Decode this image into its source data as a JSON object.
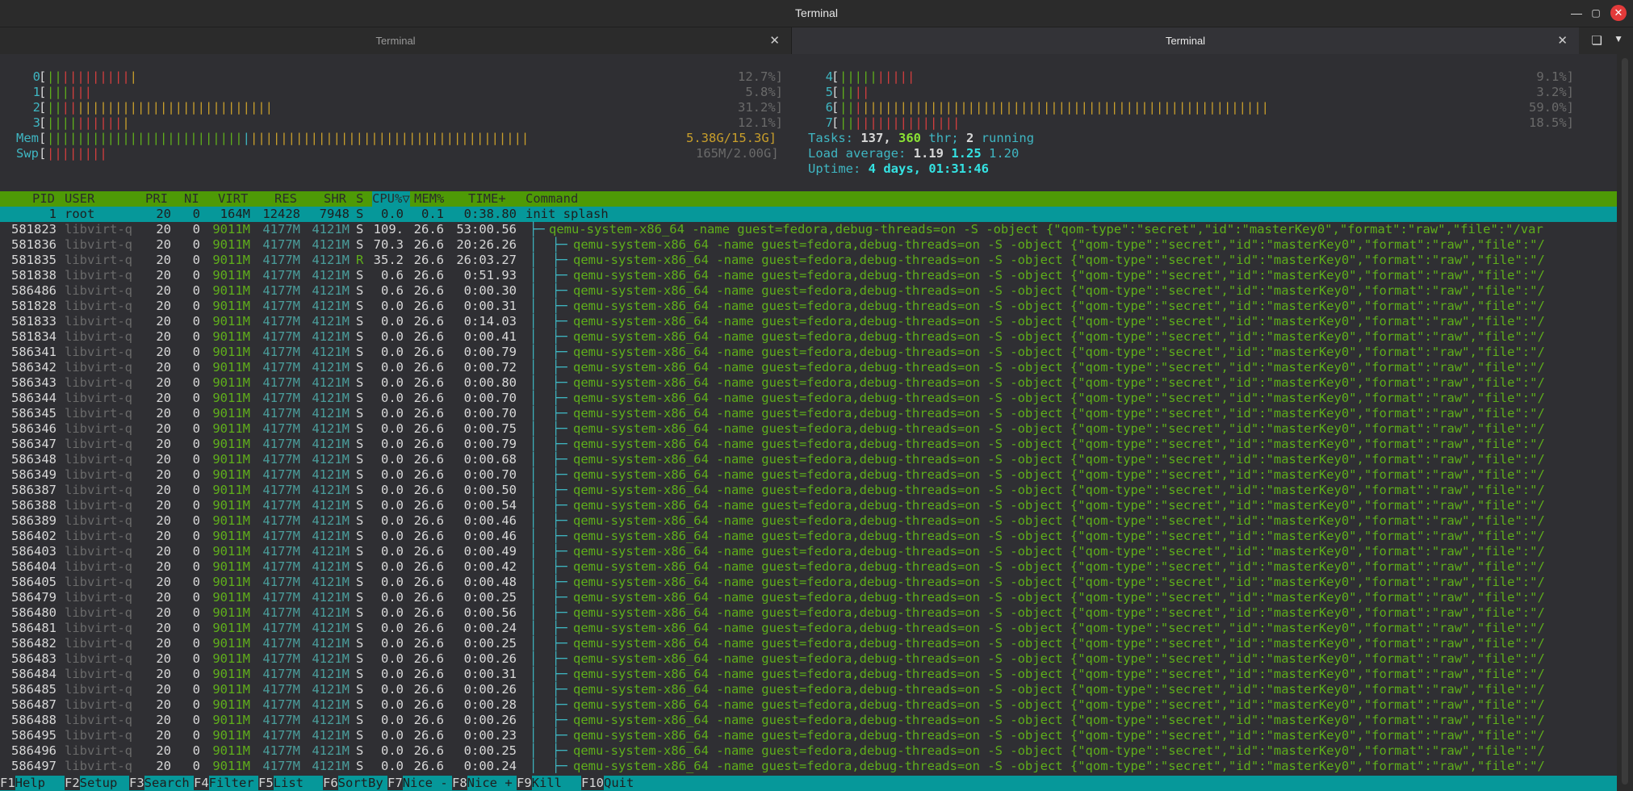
{
  "window": {
    "title": "Terminal"
  },
  "tabs": [
    {
      "label": "Terminal",
      "active": false
    },
    {
      "label": "Terminal",
      "active": true
    }
  ],
  "icons": {
    "minimize": "minimize-icon",
    "maximize": "maximize-icon",
    "close": "close-icon",
    "tab_close": "close-icon",
    "new_tab": "new-tab-icon",
    "tab_menu": "chevron-down-icon"
  },
  "meters": {
    "cpus": [
      {
        "id": "0",
        "value": "12.7%]",
        "bar_green": 2,
        "bar_red": 9,
        "bar_yellow": 1
      },
      {
        "id": "1",
        "value": "5.8%]",
        "bar_green": 3,
        "bar_red": 3,
        "bar_yellow": 0
      },
      {
        "id": "2",
        "value": "31.2%]",
        "bar_green": 2,
        "bar_red": 2,
        "bar_yellow": 26
      },
      {
        "id": "3",
        "value": "12.1%]",
        "bar_green": 4,
        "bar_red": 6,
        "bar_yellow": 1
      },
      {
        "id": "4",
        "value": "9.1%]",
        "bar_green": 5,
        "bar_red": 5,
        "bar_yellow": 0
      },
      {
        "id": "5",
        "value": "3.2%]",
        "bar_green": 2,
        "bar_red": 2,
        "bar_yellow": 0
      },
      {
        "id": "6",
        "value": "59.0%]",
        "bar_green": 2,
        "bar_red": 1,
        "bar_yellow": 54
      },
      {
        "id": "7",
        "value": "18.5%]",
        "bar_green": 2,
        "bar_red": 14,
        "bar_yellow": 0
      }
    ],
    "mem": {
      "label": "Mem",
      "value": "5.38G/15.3G]"
    },
    "swp": {
      "label": "Swp",
      "value": "165M/2.00G]"
    },
    "tasks": {
      "label": "Tasks:",
      "count": "137,",
      "thr": "360",
      "thr_label": "thr;",
      "running": "2",
      "running_label": "running"
    },
    "load": {
      "label": "Load average:",
      "l1": "1.19",
      "l5": "1.25",
      "l15": "1.20"
    },
    "uptime": {
      "label": "Uptime:",
      "value": "4 days, 01:31:46"
    }
  },
  "columns": {
    "pid": "PID",
    "user": "USER",
    "pri": "PRI",
    "ni": "NI",
    "virt": "VIRT",
    "res": "RES",
    "shr": "SHR",
    "s": "S",
    "cpu": "CPU%▽",
    "mem": "MEM%",
    "time": "TIME+",
    "command": "Command"
  },
  "processes": [
    {
      "pid": "1",
      "user": "root",
      "pri": "20",
      "ni": "0",
      "virt": "164M",
      "res": "12428",
      "shr": "7948",
      "s": "S",
      "cpu": "0.0",
      "mem": "0.1",
      "time": "0:38.80",
      "tree": "",
      "cmd": "init splash",
      "selected": true
    },
    {
      "pid": "581823",
      "user": "libvirt-q",
      "pri": "20",
      "ni": "0",
      "virt": "9011M",
      "res": "4177M",
      "shr": "4121M",
      "s": "S",
      "cpu": "109.",
      "mem": "26.6",
      "time": "53:00.56",
      "tree": "├─",
      "cmd": "qemu-system-x86_64 -name guest=fedora,debug-threads=on -S -object {\"qom-type\":\"secret\",\"id\":\"masterKey0\",\"format\":\"raw\",\"file\":\"/var"
    },
    {
      "pid": "581836",
      "user": "libvirt-q",
      "pri": "20",
      "ni": "0",
      "virt": "9011M",
      "res": "4177M",
      "shr": "4121M",
      "s": "S",
      "cpu": "70.3",
      "mem": "26.6",
      "time": "20:26.26",
      "tree": "│  ├─",
      "cmd": "qemu-system-x86_64 -name guest=fedora,debug-threads=on -S -object {\"qom-type\":\"secret\",\"id\":\"masterKey0\",\"format\":\"raw\",\"file\":\"/"
    },
    {
      "pid": "581835",
      "user": "libvirt-q",
      "pri": "20",
      "ni": "0",
      "virt": "9011M",
      "res": "4177M",
      "shr": "4121M",
      "s": "R",
      "cpu": "35.2",
      "mem": "26.6",
      "time": "26:03.27",
      "tree": "│  ├─",
      "cmd": "qemu-system-x86_64 -name guest=fedora,debug-threads=on -S -object {\"qom-type\":\"secret\",\"id\":\"masterKey0\",\"format\":\"raw\",\"file\":\"/"
    },
    {
      "pid": "581838",
      "user": "libvirt-q",
      "pri": "20",
      "ni": "0",
      "virt": "9011M",
      "res": "4177M",
      "shr": "4121M",
      "s": "S",
      "cpu": "0.6",
      "mem": "26.6",
      "time": "0:51.93",
      "tree": "│  ├─",
      "cmd": "qemu-system-x86_64 -name guest=fedora,debug-threads=on -S -object {\"qom-type\":\"secret\",\"id\":\"masterKey0\",\"format\":\"raw\",\"file\":\"/"
    },
    {
      "pid": "586486",
      "user": "libvirt-q",
      "pri": "20",
      "ni": "0",
      "virt": "9011M",
      "res": "4177M",
      "shr": "4121M",
      "s": "S",
      "cpu": "0.6",
      "mem": "26.6",
      "time": "0:00.30",
      "tree": "│  ├─",
      "cmd": "qemu-system-x86_64 -name guest=fedora,debug-threads=on -S -object {\"qom-type\":\"secret\",\"id\":\"masterKey0\",\"format\":\"raw\",\"file\":\"/"
    },
    {
      "pid": "581828",
      "user": "libvirt-q",
      "pri": "20",
      "ni": "0",
      "virt": "9011M",
      "res": "4177M",
      "shr": "4121M",
      "s": "S",
      "cpu": "0.0",
      "mem": "26.6",
      "time": "0:00.31",
      "tree": "│  ├─",
      "cmd": "qemu-system-x86_64 -name guest=fedora,debug-threads=on -S -object {\"qom-type\":\"secret\",\"id\":\"masterKey0\",\"format\":\"raw\",\"file\":\"/"
    },
    {
      "pid": "581833",
      "user": "libvirt-q",
      "pri": "20",
      "ni": "0",
      "virt": "9011M",
      "res": "4177M",
      "shr": "4121M",
      "s": "S",
      "cpu": "0.0",
      "mem": "26.6",
      "time": "0:14.03",
      "tree": "│  ├─",
      "cmd": "qemu-system-x86_64 -name guest=fedora,debug-threads=on -S -object {\"qom-type\":\"secret\",\"id\":\"masterKey0\",\"format\":\"raw\",\"file\":\"/"
    },
    {
      "pid": "581834",
      "user": "libvirt-q",
      "pri": "20",
      "ni": "0",
      "virt": "9011M",
      "res": "4177M",
      "shr": "4121M",
      "s": "S",
      "cpu": "0.0",
      "mem": "26.6",
      "time": "0:00.41",
      "tree": "│  ├─",
      "cmd": "qemu-system-x86_64 -name guest=fedora,debug-threads=on -S -object {\"qom-type\":\"secret\",\"id\":\"masterKey0\",\"format\":\"raw\",\"file\":\"/"
    },
    {
      "pid": "586341",
      "user": "libvirt-q",
      "pri": "20",
      "ni": "0",
      "virt": "9011M",
      "res": "4177M",
      "shr": "4121M",
      "s": "S",
      "cpu": "0.0",
      "mem": "26.6",
      "time": "0:00.79",
      "tree": "│  ├─",
      "cmd": "qemu-system-x86_64 -name guest=fedora,debug-threads=on -S -object {\"qom-type\":\"secret\",\"id\":\"masterKey0\",\"format\":\"raw\",\"file\":\"/"
    },
    {
      "pid": "586342",
      "user": "libvirt-q",
      "pri": "20",
      "ni": "0",
      "virt": "9011M",
      "res": "4177M",
      "shr": "4121M",
      "s": "S",
      "cpu": "0.0",
      "mem": "26.6",
      "time": "0:00.72",
      "tree": "│  ├─",
      "cmd": "qemu-system-x86_64 -name guest=fedora,debug-threads=on -S -object {\"qom-type\":\"secret\",\"id\":\"masterKey0\",\"format\":\"raw\",\"file\":\"/"
    },
    {
      "pid": "586343",
      "user": "libvirt-q",
      "pri": "20",
      "ni": "0",
      "virt": "9011M",
      "res": "4177M",
      "shr": "4121M",
      "s": "S",
      "cpu": "0.0",
      "mem": "26.6",
      "time": "0:00.80",
      "tree": "│  ├─",
      "cmd": "qemu-system-x86_64 -name guest=fedora,debug-threads=on -S -object {\"qom-type\":\"secret\",\"id\":\"masterKey0\",\"format\":\"raw\",\"file\":\"/"
    },
    {
      "pid": "586344",
      "user": "libvirt-q",
      "pri": "20",
      "ni": "0",
      "virt": "9011M",
      "res": "4177M",
      "shr": "4121M",
      "s": "S",
      "cpu": "0.0",
      "mem": "26.6",
      "time": "0:00.70",
      "tree": "│  ├─",
      "cmd": "qemu-system-x86_64 -name guest=fedora,debug-threads=on -S -object {\"qom-type\":\"secret\",\"id\":\"masterKey0\",\"format\":\"raw\",\"file\":\"/"
    },
    {
      "pid": "586345",
      "user": "libvirt-q",
      "pri": "20",
      "ni": "0",
      "virt": "9011M",
      "res": "4177M",
      "shr": "4121M",
      "s": "S",
      "cpu": "0.0",
      "mem": "26.6",
      "time": "0:00.70",
      "tree": "│  ├─",
      "cmd": "qemu-system-x86_64 -name guest=fedora,debug-threads=on -S -object {\"qom-type\":\"secret\",\"id\":\"masterKey0\",\"format\":\"raw\",\"file\":\"/"
    },
    {
      "pid": "586346",
      "user": "libvirt-q",
      "pri": "20",
      "ni": "0",
      "virt": "9011M",
      "res": "4177M",
      "shr": "4121M",
      "s": "S",
      "cpu": "0.0",
      "mem": "26.6",
      "time": "0:00.75",
      "tree": "│  ├─",
      "cmd": "qemu-system-x86_64 -name guest=fedora,debug-threads=on -S -object {\"qom-type\":\"secret\",\"id\":\"masterKey0\",\"format\":\"raw\",\"file\":\"/"
    },
    {
      "pid": "586347",
      "user": "libvirt-q",
      "pri": "20",
      "ni": "0",
      "virt": "9011M",
      "res": "4177M",
      "shr": "4121M",
      "s": "S",
      "cpu": "0.0",
      "mem": "26.6",
      "time": "0:00.79",
      "tree": "│  ├─",
      "cmd": "qemu-system-x86_64 -name guest=fedora,debug-threads=on -S -object {\"qom-type\":\"secret\",\"id\":\"masterKey0\",\"format\":\"raw\",\"file\":\"/"
    },
    {
      "pid": "586348",
      "user": "libvirt-q",
      "pri": "20",
      "ni": "0",
      "virt": "9011M",
      "res": "4177M",
      "shr": "4121M",
      "s": "S",
      "cpu": "0.0",
      "mem": "26.6",
      "time": "0:00.68",
      "tree": "│  ├─",
      "cmd": "qemu-system-x86_64 -name guest=fedora,debug-threads=on -S -object {\"qom-type\":\"secret\",\"id\":\"masterKey0\",\"format\":\"raw\",\"file\":\"/"
    },
    {
      "pid": "586349",
      "user": "libvirt-q",
      "pri": "20",
      "ni": "0",
      "virt": "9011M",
      "res": "4177M",
      "shr": "4121M",
      "s": "S",
      "cpu": "0.0",
      "mem": "26.6",
      "time": "0:00.70",
      "tree": "│  ├─",
      "cmd": "qemu-system-x86_64 -name guest=fedora,debug-threads=on -S -object {\"qom-type\":\"secret\",\"id\":\"masterKey0\",\"format\":\"raw\",\"file\":\"/"
    },
    {
      "pid": "586387",
      "user": "libvirt-q",
      "pri": "20",
      "ni": "0",
      "virt": "9011M",
      "res": "4177M",
      "shr": "4121M",
      "s": "S",
      "cpu": "0.0",
      "mem": "26.6",
      "time": "0:00.50",
      "tree": "│  ├─",
      "cmd": "qemu-system-x86_64 -name guest=fedora,debug-threads=on -S -object {\"qom-type\":\"secret\",\"id\":\"masterKey0\",\"format\":\"raw\",\"file\":\"/"
    },
    {
      "pid": "586388",
      "user": "libvirt-q",
      "pri": "20",
      "ni": "0",
      "virt": "9011M",
      "res": "4177M",
      "shr": "4121M",
      "s": "S",
      "cpu": "0.0",
      "mem": "26.6",
      "time": "0:00.54",
      "tree": "│  ├─",
      "cmd": "qemu-system-x86_64 -name guest=fedora,debug-threads=on -S -object {\"qom-type\":\"secret\",\"id\":\"masterKey0\",\"format\":\"raw\",\"file\":\"/"
    },
    {
      "pid": "586389",
      "user": "libvirt-q",
      "pri": "20",
      "ni": "0",
      "virt": "9011M",
      "res": "4177M",
      "shr": "4121M",
      "s": "S",
      "cpu": "0.0",
      "mem": "26.6",
      "time": "0:00.46",
      "tree": "│  ├─",
      "cmd": "qemu-system-x86_64 -name guest=fedora,debug-threads=on -S -object {\"qom-type\":\"secret\",\"id\":\"masterKey0\",\"format\":\"raw\",\"file\":\"/"
    },
    {
      "pid": "586402",
      "user": "libvirt-q",
      "pri": "20",
      "ni": "0",
      "virt": "9011M",
      "res": "4177M",
      "shr": "4121M",
      "s": "S",
      "cpu": "0.0",
      "mem": "26.6",
      "time": "0:00.46",
      "tree": "│  ├─",
      "cmd": "qemu-system-x86_64 -name guest=fedora,debug-threads=on -S -object {\"qom-type\":\"secret\",\"id\":\"masterKey0\",\"format\":\"raw\",\"file\":\"/"
    },
    {
      "pid": "586403",
      "user": "libvirt-q",
      "pri": "20",
      "ni": "0",
      "virt": "9011M",
      "res": "4177M",
      "shr": "4121M",
      "s": "S",
      "cpu": "0.0",
      "mem": "26.6",
      "time": "0:00.49",
      "tree": "│  ├─",
      "cmd": "qemu-system-x86_64 -name guest=fedora,debug-threads=on -S -object {\"qom-type\":\"secret\",\"id\":\"masterKey0\",\"format\":\"raw\",\"file\":\"/"
    },
    {
      "pid": "586404",
      "user": "libvirt-q",
      "pri": "20",
      "ni": "0",
      "virt": "9011M",
      "res": "4177M",
      "shr": "4121M",
      "s": "S",
      "cpu": "0.0",
      "mem": "26.6",
      "time": "0:00.42",
      "tree": "│  ├─",
      "cmd": "qemu-system-x86_64 -name guest=fedora,debug-threads=on -S -object {\"qom-type\":\"secret\",\"id\":\"masterKey0\",\"format\":\"raw\",\"file\":\"/"
    },
    {
      "pid": "586405",
      "user": "libvirt-q",
      "pri": "20",
      "ni": "0",
      "virt": "9011M",
      "res": "4177M",
      "shr": "4121M",
      "s": "S",
      "cpu": "0.0",
      "mem": "26.6",
      "time": "0:00.48",
      "tree": "│  ├─",
      "cmd": "qemu-system-x86_64 -name guest=fedora,debug-threads=on -S -object {\"qom-type\":\"secret\",\"id\":\"masterKey0\",\"format\":\"raw\",\"file\":\"/"
    },
    {
      "pid": "586479",
      "user": "libvirt-q",
      "pri": "20",
      "ni": "0",
      "virt": "9011M",
      "res": "4177M",
      "shr": "4121M",
      "s": "S",
      "cpu": "0.0",
      "mem": "26.6",
      "time": "0:00.25",
      "tree": "│  ├─",
      "cmd": "qemu-system-x86_64 -name guest=fedora,debug-threads=on -S -object {\"qom-type\":\"secret\",\"id\":\"masterKey0\",\"format\":\"raw\",\"file\":\"/"
    },
    {
      "pid": "586480",
      "user": "libvirt-q",
      "pri": "20",
      "ni": "0",
      "virt": "9011M",
      "res": "4177M",
      "shr": "4121M",
      "s": "S",
      "cpu": "0.0",
      "mem": "26.6",
      "time": "0:00.56",
      "tree": "│  ├─",
      "cmd": "qemu-system-x86_64 -name guest=fedora,debug-threads=on -S -object {\"qom-type\":\"secret\",\"id\":\"masterKey0\",\"format\":\"raw\",\"file\":\"/"
    },
    {
      "pid": "586481",
      "user": "libvirt-q",
      "pri": "20",
      "ni": "0",
      "virt": "9011M",
      "res": "4177M",
      "shr": "4121M",
      "s": "S",
      "cpu": "0.0",
      "mem": "26.6",
      "time": "0:00.24",
      "tree": "│  ├─",
      "cmd": "qemu-system-x86_64 -name guest=fedora,debug-threads=on -S -object {\"qom-type\":\"secret\",\"id\":\"masterKey0\",\"format\":\"raw\",\"file\":\"/"
    },
    {
      "pid": "586482",
      "user": "libvirt-q",
      "pri": "20",
      "ni": "0",
      "virt": "9011M",
      "res": "4177M",
      "shr": "4121M",
      "s": "S",
      "cpu": "0.0",
      "mem": "26.6",
      "time": "0:00.25",
      "tree": "│  ├─",
      "cmd": "qemu-system-x86_64 -name guest=fedora,debug-threads=on -S -object {\"qom-type\":\"secret\",\"id\":\"masterKey0\",\"format\":\"raw\",\"file\":\"/"
    },
    {
      "pid": "586483",
      "user": "libvirt-q",
      "pri": "20",
      "ni": "0",
      "virt": "9011M",
      "res": "4177M",
      "shr": "4121M",
      "s": "S",
      "cpu": "0.0",
      "mem": "26.6",
      "time": "0:00.26",
      "tree": "│  ├─",
      "cmd": "qemu-system-x86_64 -name guest=fedora,debug-threads=on -S -object {\"qom-type\":\"secret\",\"id\":\"masterKey0\",\"format\":\"raw\",\"file\":\"/"
    },
    {
      "pid": "586484",
      "user": "libvirt-q",
      "pri": "20",
      "ni": "0",
      "virt": "9011M",
      "res": "4177M",
      "shr": "4121M",
      "s": "S",
      "cpu": "0.0",
      "mem": "26.6",
      "time": "0:00.31",
      "tree": "│  ├─",
      "cmd": "qemu-system-x86_64 -name guest=fedora,debug-threads=on -S -object {\"qom-type\":\"secret\",\"id\":\"masterKey0\",\"format\":\"raw\",\"file\":\"/"
    },
    {
      "pid": "586485",
      "user": "libvirt-q",
      "pri": "20",
      "ni": "0",
      "virt": "9011M",
      "res": "4177M",
      "shr": "4121M",
      "s": "S",
      "cpu": "0.0",
      "mem": "26.6",
      "time": "0:00.26",
      "tree": "│  ├─",
      "cmd": "qemu-system-x86_64 -name guest=fedora,debug-threads=on -S -object {\"qom-type\":\"secret\",\"id\":\"masterKey0\",\"format\":\"raw\",\"file\":\"/"
    },
    {
      "pid": "586487",
      "user": "libvirt-q",
      "pri": "20",
      "ni": "0",
      "virt": "9011M",
      "res": "4177M",
      "shr": "4121M",
      "s": "S",
      "cpu": "0.0",
      "mem": "26.6",
      "time": "0:00.28",
      "tree": "│  ├─",
      "cmd": "qemu-system-x86_64 -name guest=fedora,debug-threads=on -S -object {\"qom-type\":\"secret\",\"id\":\"masterKey0\",\"format\":\"raw\",\"file\":\"/"
    },
    {
      "pid": "586488",
      "user": "libvirt-q",
      "pri": "20",
      "ni": "0",
      "virt": "9011M",
      "res": "4177M",
      "shr": "4121M",
      "s": "S",
      "cpu": "0.0",
      "mem": "26.6",
      "time": "0:00.26",
      "tree": "│  ├─",
      "cmd": "qemu-system-x86_64 -name guest=fedora,debug-threads=on -S -object {\"qom-type\":\"secret\",\"id\":\"masterKey0\",\"format\":\"raw\",\"file\":\"/"
    },
    {
      "pid": "586495",
      "user": "libvirt-q",
      "pri": "20",
      "ni": "0",
      "virt": "9011M",
      "res": "4177M",
      "shr": "4121M",
      "s": "S",
      "cpu": "0.0",
      "mem": "26.6",
      "time": "0:00.23",
      "tree": "│  ├─",
      "cmd": "qemu-system-x86_64 -name guest=fedora,debug-threads=on -S -object {\"qom-type\":\"secret\",\"id\":\"masterKey0\",\"format\":\"raw\",\"file\":\"/"
    },
    {
      "pid": "586496",
      "user": "libvirt-q",
      "pri": "20",
      "ni": "0",
      "virt": "9011M",
      "res": "4177M",
      "shr": "4121M",
      "s": "S",
      "cpu": "0.0",
      "mem": "26.6",
      "time": "0:00.25",
      "tree": "│  ├─",
      "cmd": "qemu-system-x86_64 -name guest=fedora,debug-threads=on -S -object {\"qom-type\":\"secret\",\"id\":\"masterKey0\",\"format\":\"raw\",\"file\":\"/"
    },
    {
      "pid": "586497",
      "user": "libvirt-q",
      "pri": "20",
      "ni": "0",
      "virt": "9011M",
      "res": "4177M",
      "shr": "4121M",
      "s": "S",
      "cpu": "0.0",
      "mem": "26.6",
      "time": "0:00.24",
      "tree": "│  ├─",
      "cmd": "qemu-system-x86_64 -name guest=fedora,debug-threads=on -S -object {\"qom-type\":\"secret\",\"id\":\"masterKey0\",\"format\":\"raw\",\"file\":\"/"
    }
  ],
  "footer": [
    {
      "key": "F1",
      "label": "Help  "
    },
    {
      "key": "F2",
      "label": "Setup "
    },
    {
      "key": "F3",
      "label": "Search"
    },
    {
      "key": "F4",
      "label": "Filter"
    },
    {
      "key": "F5",
      "label": "List  "
    },
    {
      "key": "F6",
      "label": "SortBy"
    },
    {
      "key": "F7",
      "label": "Nice -"
    },
    {
      "key": "F8",
      "label": "Nice +"
    },
    {
      "key": "F9",
      "label": "Kill  "
    },
    {
      "key": "F10",
      "label": "Quit"
    }
  ],
  "colors": {
    "header_bg": "#4e9a06",
    "selected_bg": "#06989a",
    "green": "#5fae1b",
    "red": "#d23e3e",
    "yellow": "#c99f2b",
    "cyan": "#3fb6c2"
  }
}
